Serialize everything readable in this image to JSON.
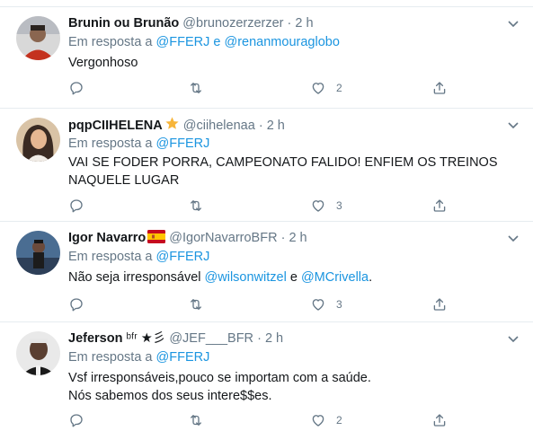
{
  "reply_prefix": "Em resposta a",
  "and_word": "e",
  "tweets": [
    {
      "name": "Brunin ou Brunão",
      "handle": "@brunozerzerzer",
      "dot": "·",
      "time": "2 h",
      "mentions": [
        "@FFERJ",
        "@renanmouraglobo"
      ],
      "text_lines": [
        "Vergonhoso"
      ],
      "likes": "2",
      "avatar_icon": "profile-photo"
    },
    {
      "name": "pqpCIIHELENA",
      "name_emoji": "star-emoji",
      "handle": "@ciihelenaa",
      "dot": "·",
      "time": "2 h",
      "mentions": [
        "@FFERJ"
      ],
      "text_lines": [
        "VAI SE FODER PORRA, CAMPEONATO FALIDO! ENFIEM OS TREINOS",
        "NAQUELE LUGAR"
      ],
      "likes": "3",
      "avatar_icon": "profile-photo"
    },
    {
      "name": "Igor Navarro",
      "name_emoji": "spain-flag-emoji",
      "handle": "@IgorNavarroBFR",
      "dot": "·",
      "time": "2 h",
      "mentions": [
        "@FFERJ"
      ],
      "text_prefix": "Não seja irresponsável ",
      "text_mention1": "@wilsonwitzel",
      "text_mid": " e ",
      "text_mention2": "@MCrivella",
      "text_suffix": ".",
      "likes": "3",
      "avatar_icon": "profile-photo"
    },
    {
      "name": "Jeferson",
      "name_suffix": "ᵇᶠʳ ★彡",
      "handle": "@JEF___BFR",
      "dot": "·",
      "time": "2 h",
      "mentions": [
        "@FFERJ"
      ],
      "text_lines": [
        "Vsf irresponsáveis,pouco se importam com a saúde.",
        "Nós sabemos dos seus intere$$es."
      ],
      "likes": "2",
      "avatar_icon": "profile-photo"
    }
  ],
  "colors": {
    "text": "#14171a",
    "secondary": "#657786",
    "link": "#1b95e0",
    "divider": "#e6ecf0"
  }
}
